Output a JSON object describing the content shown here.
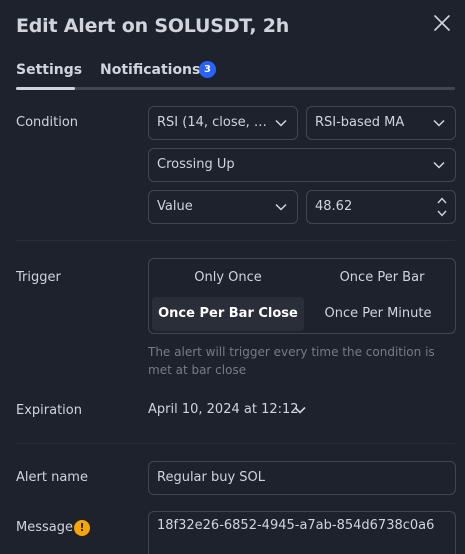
{
  "header": {
    "title": "Edit Alert on SOLUSDT, 2h"
  },
  "tabs": {
    "settings": "Settings",
    "notifications": "Notifications",
    "notifications_badge": "3"
  },
  "condition": {
    "label": "Condition",
    "indicator": "RSI (14, close, S...",
    "indicator_plot": "RSI-based MA",
    "operator": "Crossing Up",
    "target_type": "Value",
    "target_value": "48.62"
  },
  "trigger": {
    "label": "Trigger",
    "options": [
      "Only Once",
      "Once Per Bar",
      "Once Per Bar Close",
      "Once Per Minute"
    ],
    "selected": "Once Per Bar Close",
    "hint": "The alert will trigger every time the condition is met at bar close"
  },
  "expiration": {
    "label": "Expiration",
    "value": "April 10, 2024 at 12:12"
  },
  "alert_name": {
    "label": "Alert name",
    "value": "Regular buy SOL"
  },
  "message": {
    "label": "Message",
    "warning_icon": "!",
    "value": "18f32e26-6852-4945-a7ab-854d6738c0a6"
  },
  "colors": {
    "background": "#1e222d",
    "border": "#434651",
    "accent": "#2962ff",
    "warning": "#f7a600"
  }
}
